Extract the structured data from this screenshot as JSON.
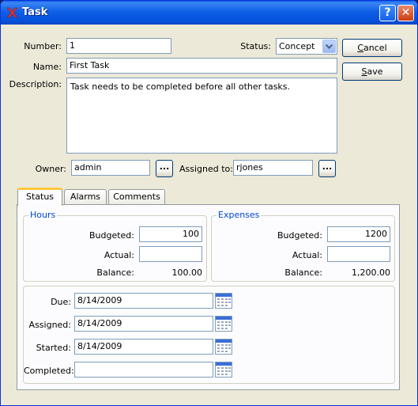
{
  "window": {
    "title": "Task",
    "help": "?",
    "close": "✕"
  },
  "form": {
    "number_label": "Number:",
    "number": "1",
    "status_label": "Status:",
    "status": "Concept",
    "name_label": "Name:",
    "name": "First Task",
    "description_label": "Description:",
    "description": "Task needs to be  completed before all other tasks.",
    "owner_label": "Owner:",
    "owner": "admin",
    "assigned_to_label": "Assigned to:",
    "assigned_to": "rjones",
    "browse": "..."
  },
  "buttons": {
    "cancel_prefix": "",
    "cancel_key": "C",
    "cancel_rest": "ancel",
    "save_prefix": "",
    "save_key": "S",
    "save_rest": "ave"
  },
  "tabs": [
    "Status",
    "Alarms",
    "Comments"
  ],
  "hours": {
    "title": "Hours",
    "budgeted_label": "Budgeted:",
    "budgeted": "100",
    "actual_label": "Actual:",
    "actual": "",
    "balance_label": "Balance:",
    "balance": "100.00"
  },
  "expenses": {
    "title": "Expenses",
    "budgeted_label": "Budgeted:",
    "budgeted": "1200",
    "actual_label": "Actual:",
    "actual": "",
    "balance_label": "Balance:",
    "balance": "1,200.00"
  },
  "dates": {
    "due_label": "Due:",
    "due": "8/14/2009",
    "assigned_label": "Assigned:",
    "assigned": "8/14/2009",
    "started_label": "Started:",
    "started": "8/14/2009",
    "completed_label": "Completed:",
    "completed": ""
  },
  "colors": {
    "titlebar": "#0a5fe8",
    "group_title": "#0046d5",
    "active_tab": "#ffc83c"
  }
}
